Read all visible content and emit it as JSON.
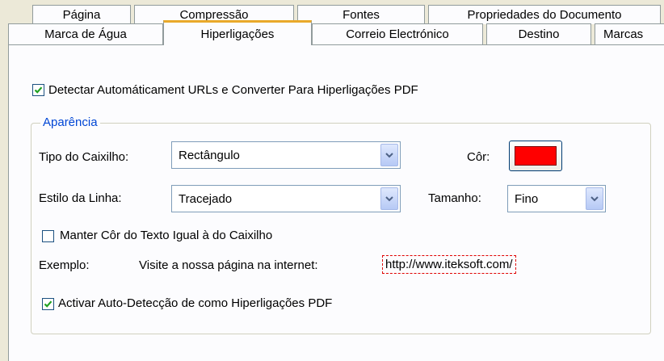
{
  "tabs_row1": [
    "Página",
    "Compressão",
    "Fontes",
    "Propriedades do Documento"
  ],
  "tabs_row2": [
    "Marca de Água",
    "Hiperligações",
    "Correio Electrónico",
    "Destino",
    "Marcas"
  ],
  "active_tab": "Hiperligações",
  "auto_detect": {
    "label": "Detectar Automáticament URLs e Converter Para Hiperligações PDF",
    "checked": true
  },
  "appearance": {
    "legend": "Aparência",
    "frame_type_label": "Tipo do Caixilho:",
    "frame_type_value": "Rectângulo",
    "color_label": "Côr:",
    "color_value": "#ff0000",
    "line_style_label": "Estilo da Linha:",
    "line_style_value": "Tracejado",
    "size_label": "Tamanho:",
    "size_value": "Fino",
    "keep_color": {
      "label": "Manter Côr do Texto Igual à do Caixilho",
      "checked": false
    },
    "example_label": "Exemplo:",
    "example_text": "Visite a nossa página na internet:",
    "example_link": "http://www.iteksoft.com/",
    "activate_autodetect": {
      "label": "Activar Auto-Detecção de como Hiperligações PDF",
      "checked": true
    }
  },
  "colors": {
    "accent_tab": "#e9a92a",
    "legend": "#0046d5",
    "checkmark": "#21a121"
  }
}
